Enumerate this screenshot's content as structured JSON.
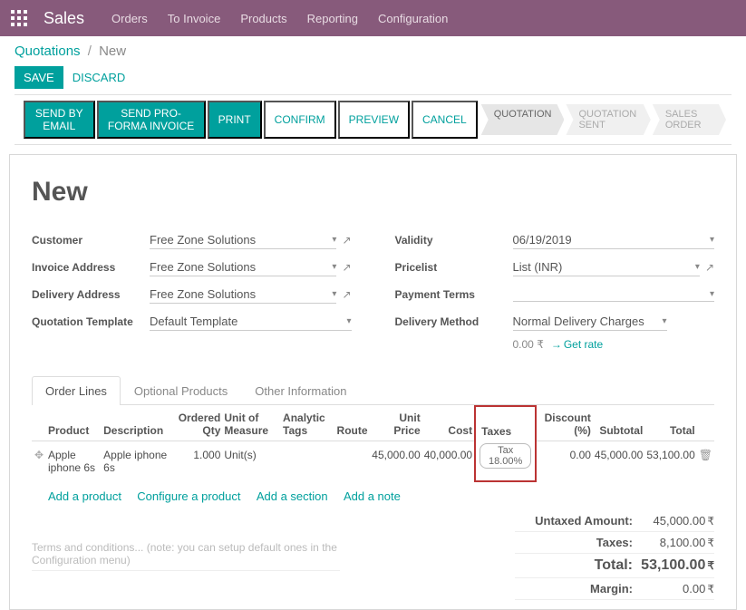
{
  "nav": {
    "app_title": "Sales",
    "menu": [
      "Orders",
      "To Invoice",
      "Products",
      "Reporting",
      "Configuration"
    ]
  },
  "breadcrumb": {
    "parent": "Quotations",
    "sep": "/",
    "current": "New"
  },
  "actions": {
    "save": "SAVE",
    "discard": "DISCARD"
  },
  "status_buttons": {
    "send_email": "SEND BY EMAIL",
    "send_proforma": "SEND PRO-FORMA INVOICE",
    "print": "PRINT",
    "confirm": "CONFIRM",
    "preview": "PREVIEW",
    "cancel": "CANCEL"
  },
  "steps": {
    "quotation": "QUOTATION",
    "quotation_sent": "QUOTATION SENT",
    "sales_order": "SALES ORDER"
  },
  "sheet": {
    "title": "New",
    "left_fields": {
      "customer_label": "Customer",
      "customer_value": "Free Zone Solutions",
      "invoice_label": "Invoice Address",
      "invoice_value": "Free Zone Solutions",
      "delivery_label": "Delivery Address",
      "delivery_value": "Free Zone Solutions",
      "template_label": "Quotation Template",
      "template_value": "Default Template"
    },
    "right_fields": {
      "validity_label": "Validity",
      "validity_value": "06/19/2019",
      "pricelist_label": "Pricelist",
      "pricelist_value": "List (INR)",
      "payment_label": "Payment Terms",
      "payment_value": "",
      "delivery_method_label": "Delivery Method",
      "delivery_method_value": "Normal Delivery Charges",
      "rate_value": "0.00 ₹",
      "rate_link": "Get rate"
    }
  },
  "tabs": {
    "order_lines": "Order Lines",
    "optional": "Optional Products",
    "other": "Other Information"
  },
  "table": {
    "headers": {
      "product": "Product",
      "description": "Description",
      "ordered_qty": "Ordered Qty",
      "uom": "Unit of Measure",
      "analytic": "Analytic Tags",
      "route": "Route",
      "unit_price": "Unit Price",
      "cost": "Cost",
      "taxes": "Taxes",
      "discount": "Discount (%)",
      "subtotal": "Subtotal",
      "total": "Total"
    },
    "rows": [
      {
        "product": "Apple iphone 6s",
        "description": "Apple iphone 6s",
        "qty": "1.000",
        "uom": "Unit(s)",
        "unit_price": "45,000.00",
        "cost": "40,000.00",
        "tax": "Tax 18.00%",
        "discount": "0.00",
        "subtotal": "45,000.00",
        "total": "53,100.00"
      }
    ],
    "add_product": "Add a product",
    "configure": "Configure a product",
    "add_section": "Add a section",
    "add_note": "Add a note"
  },
  "terms_placeholder": "Terms and conditions... (note: you can setup default ones in the Configuration menu)",
  "totals": {
    "untaxed_label": "Untaxed Amount:",
    "untaxed_value": "45,000.00",
    "taxes_label": "Taxes:",
    "taxes_value": "8,100.00",
    "total_label": "Total:",
    "total_value": "53,100.00",
    "margin_label": "Margin:",
    "margin_value": "0.00",
    "currency": "₹"
  }
}
